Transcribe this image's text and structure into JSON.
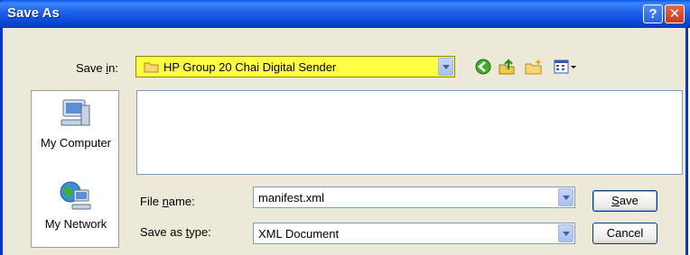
{
  "window": {
    "title": "Save As",
    "help_glyph": "?",
    "close_glyph": "✕"
  },
  "save_in": {
    "label_prefix": "Save ",
    "label_accel": "i",
    "label_suffix": "n:",
    "value": "HP Group 20 Chai Digital Sender"
  },
  "toolbar": {
    "icons": [
      "back-icon",
      "up-folder-icon",
      "new-folder-icon",
      "views-menu-icon"
    ]
  },
  "places": [
    {
      "label": "My Computer",
      "icon": "my-computer-icon"
    },
    {
      "label": "My Network",
      "icon": "my-network-icon"
    }
  ],
  "file_name": {
    "label_prefix": "File ",
    "label_accel": "n",
    "label_suffix": "ame:",
    "value": "manifest.xml"
  },
  "save_as_type": {
    "label_prefix": "Save as ",
    "label_accel": "t",
    "label_suffix": "ype:",
    "value": "XML Document"
  },
  "buttons": {
    "save_accel": "S",
    "save_rest": "ave",
    "cancel": "Cancel"
  },
  "colors": {
    "highlight": "#ffff44",
    "titlebar": "#0a4bd9",
    "dialog_bg": "#ece9d8"
  }
}
